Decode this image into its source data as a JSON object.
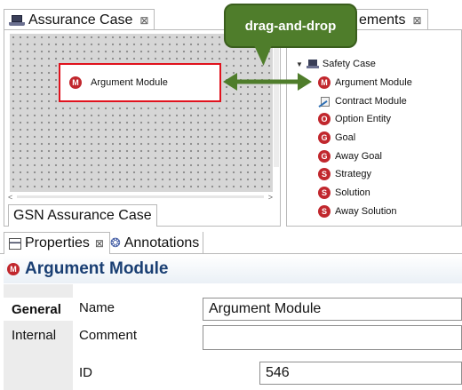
{
  "editor": {
    "tab_label": "Assurance Case",
    "bottom_tab_label": "GSN Assurance Case",
    "node": {
      "badge": "M",
      "label": "Argument Module"
    }
  },
  "palette": {
    "tab_label": "ements",
    "items": [
      {
        "label": "Safety Case",
        "icon": "laptop-icon"
      },
      {
        "label": "Argument Module",
        "icon": "module-icon",
        "badge": "M",
        "color": "#c1272d"
      },
      {
        "label": "Contract Module",
        "icon": "contract-icon"
      },
      {
        "label": "Option Entity",
        "icon": "option-icon",
        "badge": "O",
        "color": "#c1272d"
      },
      {
        "label": "Goal",
        "icon": "goal-icon",
        "badge": "G",
        "color": "#c1272d"
      },
      {
        "label": "Away Goal",
        "icon": "away-goal-icon",
        "badge": "G",
        "color": "#c1272d"
      },
      {
        "label": "Strategy",
        "icon": "strategy-icon",
        "badge": "S",
        "color": "#c1272d"
      },
      {
        "label": "Solution",
        "icon": "solution-icon",
        "badge": "S",
        "color": "#c1272d"
      },
      {
        "label": "Away Solution",
        "icon": "away-solution-icon",
        "badge": "S",
        "color": "#c1272d"
      }
    ]
  },
  "callout": {
    "label": "drag-and-drop",
    "color": "#4f7d2b"
  },
  "properties": {
    "tabs": [
      {
        "label": "Properties",
        "icon": "properties-icon"
      },
      {
        "label": "Annotations",
        "icon": "annotations-icon"
      }
    ],
    "title": "Argument Module",
    "title_badge": "M",
    "side_tabs": [
      "General",
      "Internal"
    ],
    "fields": {
      "name_label": "Name",
      "name_value": "Argument Module",
      "comment_label": "Comment",
      "comment_value": "",
      "id_label": "ID",
      "id_value": "546"
    }
  }
}
